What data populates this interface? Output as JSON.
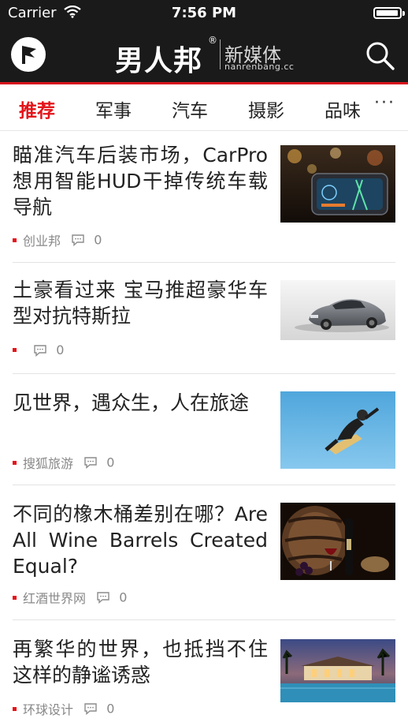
{
  "status_bar": {
    "carrier": "Carrier",
    "time": "7:56 PM"
  },
  "header": {
    "logo_main": "男人邦",
    "logo_registered": "®",
    "logo_sub": "新媒体",
    "logo_url": "nanrenbang.cc"
  },
  "tabs": [
    {
      "label": "推荐",
      "active": true
    },
    {
      "label": "军事"
    },
    {
      "label": "汽车"
    },
    {
      "label": "摄影"
    },
    {
      "label": "品味"
    }
  ],
  "tabs_more": "···",
  "articles": [
    {
      "title": "瞄准汽车后装市场，CarPro想用智能HUD干掉传统车载导航",
      "source": "创业邦",
      "comments": "0"
    },
    {
      "title": "土豪看过来 宝马推超豪华车型对抗特斯拉",
      "source": "",
      "comments": "0"
    },
    {
      "title": "见世界，遇众生，人在旅途",
      "source": "搜狐旅游",
      "comments": "0"
    },
    {
      "title": "不同的橡木桶差别在哪？Are All Wine Barrels Created Equal?",
      "source": "红酒世界网",
      "comments": "0"
    },
    {
      "title": "再繁华的世界，也抵挡不住这样的静谧诱惑",
      "source": "环球设计",
      "comments": "0"
    }
  ],
  "colors": {
    "accent": "#e3141a",
    "header_bg": "#1a1a1a"
  }
}
